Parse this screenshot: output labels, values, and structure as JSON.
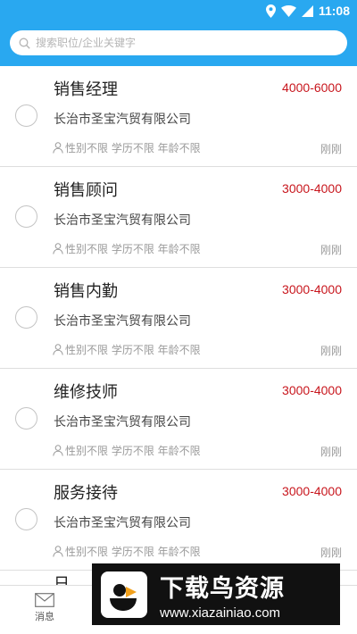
{
  "status_bar": {
    "time": "11:08"
  },
  "search": {
    "placeholder": "搜索职位/企业关键字"
  },
  "jobs": [
    {
      "title": "销售经理",
      "salary": "4000-6000",
      "company": "长治市圣宝汽贸有限公司",
      "requirements": "性别不限 学历不限 年龄不限",
      "time": "刚刚"
    },
    {
      "title": "销售顾问",
      "salary": "3000-4000",
      "company": "长治市圣宝汽贸有限公司",
      "requirements": "性别不限 学历不限 年龄不限",
      "time": "刚刚"
    },
    {
      "title": "销售内勤",
      "salary": "3000-4000",
      "company": "长治市圣宝汽贸有限公司",
      "requirements": "性别不限 学历不限 年龄不限",
      "time": "刚刚"
    },
    {
      "title": "维修技师",
      "salary": "3000-4000",
      "company": "长治市圣宝汽贸有限公司",
      "requirements": "性别不限 学历不限 年龄不限",
      "time": "刚刚"
    },
    {
      "title": "服务接待",
      "salary": "3000-4000",
      "company": "长治市圣宝汽贸有限公司",
      "requirements": "性别不限 学历不限 年龄不限",
      "time": "刚刚"
    }
  ],
  "partial_row_title": "日 ",
  "tabbar": {
    "messages_label": "消息"
  },
  "watermark": {
    "title": "下载鸟资源",
    "url": "www.xiazainiao.com"
  },
  "colors": {
    "header": "#29a8f0",
    "salary": "#c8161d"
  }
}
